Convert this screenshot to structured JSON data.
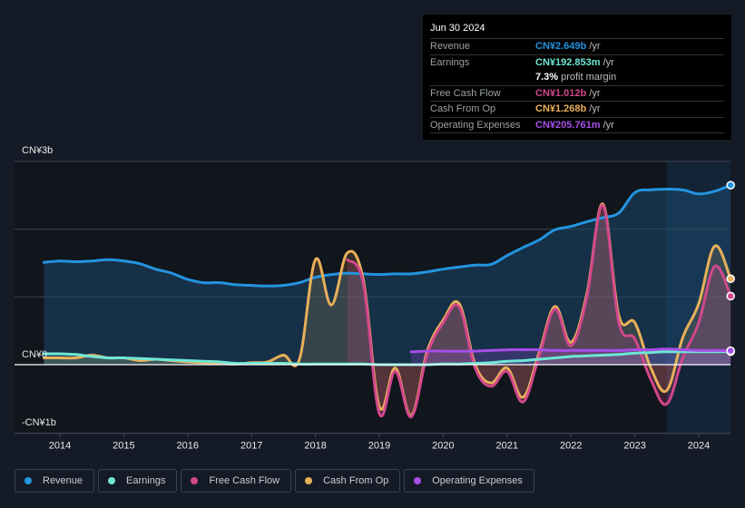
{
  "tooltip": {
    "date": "Jun 30 2024",
    "rows": [
      {
        "label": "Revenue",
        "value": "CN¥2.649b",
        "unit": "/yr",
        "color": "#2394df"
      },
      {
        "label": "Earnings",
        "value": "CN¥192.853m",
        "unit": "/yr",
        "color": "#6ee7d5"
      },
      {
        "label": "",
        "value": "7.3%",
        "unit": "profit margin",
        "color": "#ffffff"
      },
      {
        "label": "Free Cash Flow",
        "value": "CN¥1.012b",
        "unit": "/yr",
        "color": "#d1478c"
      },
      {
        "label": "Cash From Op",
        "value": "CN¥1.268b",
        "unit": "/yr",
        "color": "#e8b05a"
      },
      {
        "label": "Operating Expenses",
        "value": "CN¥205.761m",
        "unit": "/yr",
        "color": "#a64ee8"
      }
    ]
  },
  "legend": [
    {
      "label": "Revenue",
      "color": "#2394df"
    },
    {
      "label": "Earnings",
      "color": "#6ee7d5"
    },
    {
      "label": "Free Cash Flow",
      "color": "#d1478c"
    },
    {
      "label": "Cash From Op",
      "color": "#e8b05a"
    },
    {
      "label": "Operating Expenses",
      "color": "#a64ee8"
    }
  ],
  "chart_data": {
    "type": "line",
    "title": "",
    "xlabel": "",
    "ylabel": "",
    "currency": "CN¥",
    "units": "billions",
    "ylim": [
      -1,
      3
    ],
    "xlim": [
      2013.75,
      2024.5
    ],
    "y_tick_labels": [
      {
        "value": 3,
        "label": "CN¥3b"
      },
      {
        "value": 0,
        "label": "CN¥0"
      },
      {
        "value": -1,
        "label": "-CN¥1b"
      }
    ],
    "x_ticks": [
      2014,
      2015,
      2016,
      2017,
      2018,
      2019,
      2020,
      2021,
      2022,
      2023,
      2024
    ],
    "x_tick_labels": [
      "2014",
      "2015",
      "2016",
      "2017",
      "2018",
      "2019",
      "2020",
      "2021",
      "2022",
      "2023",
      "2024"
    ],
    "grid": true,
    "highlight_range": [
      2023.5,
      2024.5
    ],
    "legend_position": "bottom",
    "series": [
      {
        "name": "Revenue",
        "color": "#2394df",
        "fill": true,
        "x": [
          2013.75,
          2014.0,
          2014.25,
          2014.5,
          2014.75,
          2015.0,
          2015.25,
          2015.5,
          2015.75,
          2016.0,
          2016.25,
          2016.5,
          2016.75,
          2017.0,
          2017.25,
          2017.5,
          2017.75,
          2018.0,
          2018.25,
          2018.5,
          2018.75,
          2019.0,
          2019.25,
          2019.5,
          2019.75,
          2020.0,
          2020.25,
          2020.5,
          2020.75,
          2021.0,
          2021.25,
          2021.5,
          2021.75,
          2022.0,
          2022.25,
          2022.5,
          2022.75,
          2023.0,
          2023.25,
          2023.5,
          2023.75,
          2024.0,
          2024.25,
          2024.5
        ],
        "values": [
          1.51,
          1.53,
          1.52,
          1.53,
          1.55,
          1.53,
          1.49,
          1.41,
          1.35,
          1.26,
          1.21,
          1.21,
          1.18,
          1.17,
          1.16,
          1.17,
          1.21,
          1.29,
          1.33,
          1.35,
          1.34,
          1.33,
          1.34,
          1.34,
          1.37,
          1.41,
          1.44,
          1.47,
          1.48,
          1.61,
          1.73,
          1.84,
          1.99,
          2.04,
          2.11,
          2.17,
          2.24,
          2.54,
          2.58,
          2.59,
          2.58,
          2.52,
          2.56,
          2.649
        ]
      },
      {
        "name": "Earnings",
        "color": "#6ee7d5",
        "fill": true,
        "x": [
          2013.75,
          2014.0,
          2014.25,
          2014.5,
          2014.75,
          2015.0,
          2015.25,
          2015.5,
          2015.75,
          2016.0,
          2016.25,
          2016.5,
          2016.75,
          2017.0,
          2017.25,
          2017.5,
          2017.75,
          2018.0,
          2018.25,
          2018.5,
          2018.75,
          2019.0,
          2019.25,
          2019.5,
          2019.75,
          2020.0,
          2020.25,
          2020.5,
          2020.75,
          2021.0,
          2021.25,
          2021.5,
          2021.75,
          2022.0,
          2022.25,
          2022.5,
          2022.75,
          2023.0,
          2023.25,
          2023.5,
          2023.75,
          2024.0,
          2024.25,
          2024.5
        ],
        "values": [
          0.16,
          0.16,
          0.15,
          0.12,
          0.1,
          0.1,
          0.09,
          0.08,
          0.07,
          0.06,
          0.05,
          0.04,
          0.02,
          0.02,
          0.02,
          0.02,
          0.01,
          0.01,
          0.01,
          0.01,
          0.01,
          0.0,
          0.0,
          0.0,
          0.0,
          0.01,
          0.01,
          0.02,
          0.03,
          0.05,
          0.06,
          0.08,
          0.1,
          0.12,
          0.13,
          0.14,
          0.15,
          0.17,
          0.18,
          0.19,
          0.19,
          0.19,
          0.19,
          0.193
        ]
      },
      {
        "name": "Free Cash Flow",
        "color": "#d1478c",
        "fill": true,
        "x": [
          2018.5,
          2018.75,
          2019.0,
          2019.25,
          2019.5,
          2019.75,
          2020.0,
          2020.25,
          2020.5,
          2020.75,
          2021.0,
          2021.25,
          2021.5,
          2021.75,
          2022.0,
          2022.25,
          2022.5,
          2022.75,
          2023.0,
          2023.25,
          2023.5,
          2023.75,
          2024.0,
          2024.25,
          2024.5
        ],
        "values": [
          1.55,
          1.2,
          -0.72,
          -0.1,
          -0.77,
          0.15,
          0.62,
          0.85,
          -0.05,
          -0.32,
          -0.1,
          -0.55,
          0.12,
          0.82,
          0.28,
          1.0,
          2.35,
          0.62,
          0.38,
          -0.22,
          -0.58,
          0.1,
          0.62,
          1.45,
          1.012
        ]
      },
      {
        "name": "Cash From Op",
        "color": "#e8b05a",
        "fill": true,
        "x": [
          2013.75,
          2014.0,
          2014.25,
          2014.5,
          2014.75,
          2015.0,
          2015.25,
          2015.5,
          2015.75,
          2016.0,
          2016.25,
          2016.5,
          2016.75,
          2017.0,
          2017.25,
          2017.5,
          2017.75,
          2018.0,
          2018.25,
          2018.5,
          2018.75,
          2019.0,
          2019.25,
          2019.5,
          2019.75,
          2020.0,
          2020.25,
          2020.5,
          2020.75,
          2021.0,
          2021.25,
          2021.5,
          2021.75,
          2022.0,
          2022.25,
          2022.5,
          2022.75,
          2023.0,
          2023.25,
          2023.5,
          2023.75,
          2024.0,
          2024.25,
          2024.5
        ],
        "values": [
          0.1,
          0.1,
          0.1,
          0.14,
          0.1,
          0.1,
          0.06,
          0.08,
          0.06,
          0.04,
          0.03,
          0.02,
          0.01,
          0.03,
          0.04,
          0.14,
          0.08,
          1.55,
          0.88,
          1.65,
          1.25,
          -0.62,
          -0.05,
          -0.75,
          0.2,
          0.66,
          0.9,
          0.0,
          -0.27,
          -0.05,
          -0.48,
          0.17,
          0.86,
          0.33,
          1.05,
          2.37,
          0.72,
          0.62,
          -0.05,
          -0.38,
          0.4,
          0.9,
          1.75,
          1.268
        ]
      },
      {
        "name": "Operating Expenses",
        "color": "#a64ee8",
        "fill": true,
        "x": [
          2019.5,
          2019.75,
          2020.0,
          2020.25,
          2020.5,
          2020.75,
          2021.0,
          2021.25,
          2021.5,
          2021.75,
          2022.0,
          2022.25,
          2022.5,
          2022.75,
          2023.0,
          2023.25,
          2023.5,
          2023.75,
          2024.0,
          2024.25,
          2024.5
        ],
        "values": [
          0.19,
          0.2,
          0.2,
          0.2,
          0.2,
          0.21,
          0.22,
          0.22,
          0.22,
          0.21,
          0.21,
          0.21,
          0.21,
          0.21,
          0.22,
          0.22,
          0.23,
          0.22,
          0.21,
          0.21,
          0.206
        ]
      }
    ]
  }
}
